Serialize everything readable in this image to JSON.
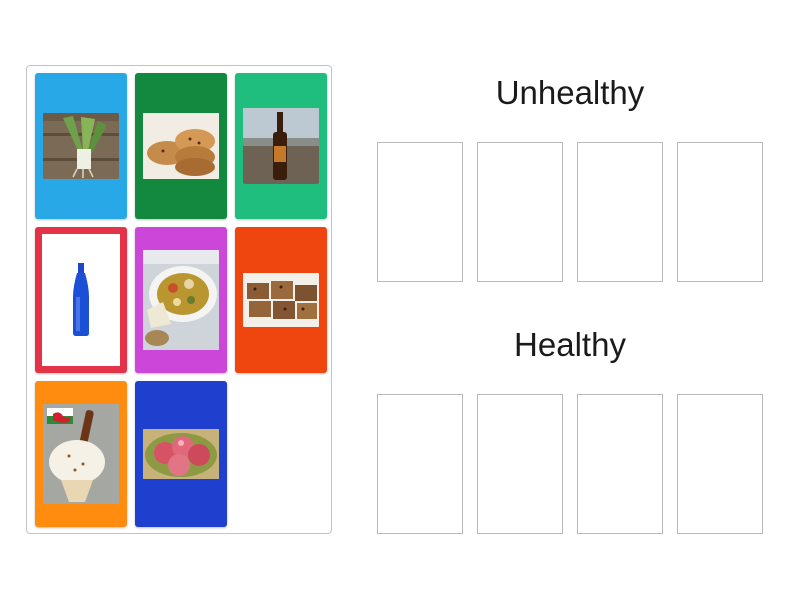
{
  "groups": {
    "unhealthy": {
      "title": "Unhealthy",
      "slot_count": 4
    },
    "healthy": {
      "title": "Healthy",
      "slot_count": 4
    }
  },
  "cards": [
    {
      "id": "leeks",
      "color": "#29a8e8",
      "image": "leeks-photo"
    },
    {
      "id": "welsh-cakes",
      "color": "#12893f",
      "image": "welsh-cakes-photo"
    },
    {
      "id": "beer-bottle",
      "color": "#1fbd7e",
      "image": "beer-bottle-photo"
    },
    {
      "id": "water-bottle",
      "color": "#e43248",
      "image": "water-bottle-photo"
    },
    {
      "id": "cawl-stew",
      "color": "#cc46d9",
      "image": "cawl-stew-photo"
    },
    {
      "id": "bara-brith",
      "color": "#ef450e",
      "image": "bara-brith-photo"
    },
    {
      "id": "ice-cream",
      "color": "#ff8c0f",
      "image": "ice-cream-photo"
    },
    {
      "id": "apples",
      "color": "#1f3fce",
      "image": "apples-photo"
    }
  ]
}
